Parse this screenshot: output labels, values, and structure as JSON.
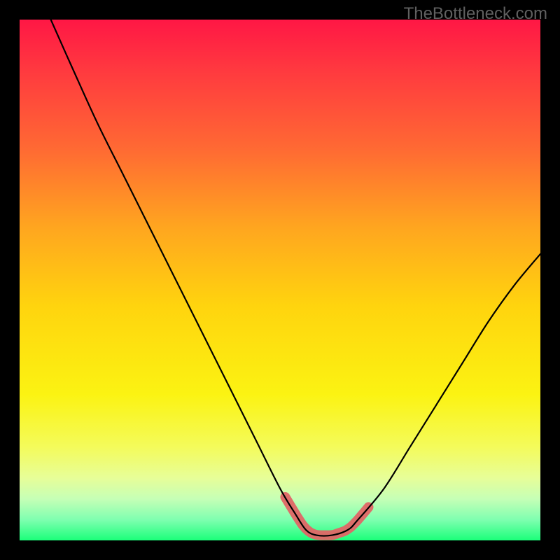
{
  "watermark": "TheBottleneck.com",
  "chart_data": {
    "type": "line",
    "title": "",
    "xlabel": "",
    "ylabel": "",
    "xlim": [
      0,
      100
    ],
    "ylim": [
      0,
      100
    ],
    "grid": false,
    "series": [
      {
        "name": "bottleneck-curve",
        "x": [
          6,
          10,
          15,
          20,
          25,
          30,
          35,
          40,
          45,
          50,
          53,
          55,
          57,
          60,
          63,
          65,
          70,
          75,
          80,
          85,
          90,
          95,
          100
        ],
        "y": [
          100,
          91,
          80,
          70,
          60,
          50,
          40,
          30,
          20,
          10,
          5,
          2,
          1,
          1,
          2,
          4,
          10,
          18,
          26,
          34,
          42,
          49,
          55
        ]
      }
    ],
    "annotations": [
      {
        "name": "optimal-band",
        "type": "highlight",
        "x_range": [
          51,
          67
        ],
        "y_approx": 2,
        "color": "#e06666"
      }
    ],
    "background_gradient": {
      "direction": "vertical",
      "stops": [
        {
          "pos": 0.0,
          "color": "#ff1745"
        },
        {
          "pos": 0.1,
          "color": "#ff3a3f"
        },
        {
          "pos": 0.25,
          "color": "#ff6a33"
        },
        {
          "pos": 0.4,
          "color": "#ffa61f"
        },
        {
          "pos": 0.55,
          "color": "#ffd40e"
        },
        {
          "pos": 0.72,
          "color": "#fbf312"
        },
        {
          "pos": 0.82,
          "color": "#f4fb5a"
        },
        {
          "pos": 0.88,
          "color": "#e7fe98"
        },
        {
          "pos": 0.92,
          "color": "#c6ffb6"
        },
        {
          "pos": 0.96,
          "color": "#7fffb0"
        },
        {
          "pos": 1.0,
          "color": "#1bff7a"
        }
      ]
    }
  }
}
